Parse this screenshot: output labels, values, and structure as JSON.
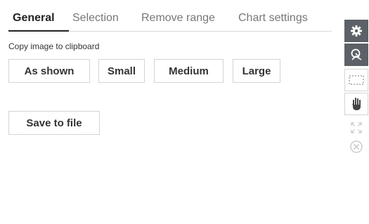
{
  "tabs": [
    {
      "label": "General",
      "active": true
    },
    {
      "label": "Selection",
      "active": false
    },
    {
      "label": "Remove range",
      "active": false
    },
    {
      "label": "Chart settings",
      "active": false
    }
  ],
  "copy_section": {
    "label": "Copy image to clipboard",
    "buttons": [
      {
        "label": "As shown"
      },
      {
        "label": "Small"
      },
      {
        "label": "Medium"
      },
      {
        "label": "Large"
      }
    ]
  },
  "save_button": {
    "label": "Save to file"
  },
  "toolbar": {
    "icons": [
      "gear-icon",
      "zoom-select-icon",
      "marquee-select-icon",
      "pan-hand-icon",
      "expand-icon",
      "close-circle-icon"
    ],
    "colors": {
      "dark": "#5b6166",
      "muted": "#cfcfcf"
    }
  }
}
